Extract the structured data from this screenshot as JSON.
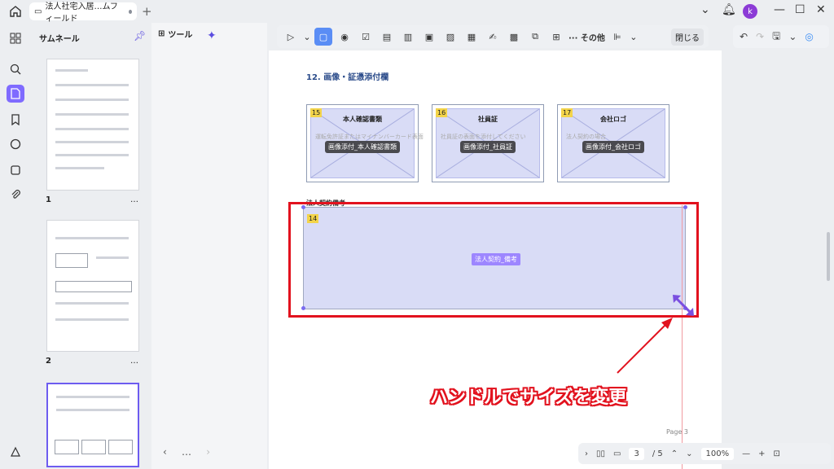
{
  "tab": {
    "title": "法人社宅入居…ムフィールド"
  },
  "user": {
    "initial": "k"
  },
  "thumbs": {
    "title": "サムネール",
    "pages": [
      "1",
      "2"
    ],
    "more": "…"
  },
  "tools": {
    "label": "ツール"
  },
  "toolbar": {
    "other_label": "その他",
    "close_label": "閉じる"
  },
  "doc": {
    "section_title": "12. 画像・証憑添付欄",
    "fields": [
      {
        "num": "15",
        "label": "本人確認書類",
        "faint": "運転免許証またはマイナンバーカード表面",
        "chip": "画像添付_本人確認書類"
      },
      {
        "num": "16",
        "label": "社員証",
        "faint": "社員証の表面を添付してください",
        "chip": "画像添付_社員証"
      },
      {
        "num": "17",
        "label": "会社ロゴ",
        "faint": "法人契約の場合",
        "chip": "画像添付_会社ロゴ"
      }
    ],
    "remarks_head": "法人契約備考",
    "big_field": {
      "num": "14",
      "chip": "法人契約_備考"
    },
    "page_label": "Page 3"
  },
  "callout": "ハンドルでサイズを変更",
  "bottom": {
    "page": "3",
    "total": "/ 5",
    "zoom": "100%"
  },
  "colors": {
    "accent": "#7f6bff",
    "highlight": "#e2121e"
  }
}
